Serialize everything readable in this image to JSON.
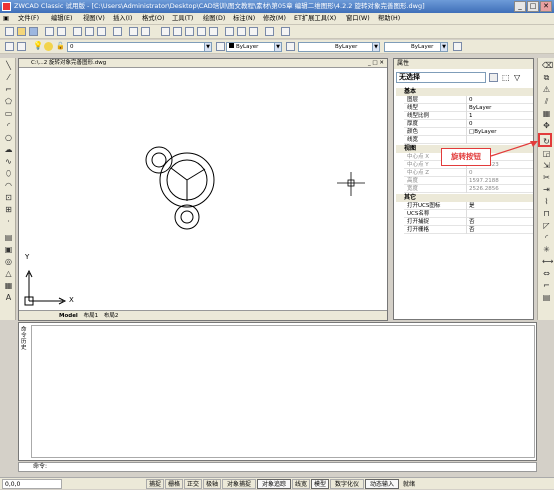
{
  "window": {
    "title": "ZWCAD Classic 试用版 - [C:\\Users\\Administrator\\Desktop\\CAD培训\\图文教程\\素材\\第05章 编辑二维图形\\4.2.2 旋转对象完善图形.dwg]",
    "min": "_",
    "max": "□",
    "close": "✕"
  },
  "menu": [
    "文件(F)",
    "编辑(E)",
    "视图(V)",
    "插入(I)",
    "格式(O)",
    "工具(T)",
    "绘图(D)",
    "标注(N)",
    "修改(M)",
    "ET扩展工具(X)",
    "窗口(W)",
    "帮助(H)"
  ],
  "toolbar": {
    "layer_value": "0",
    "color_value": "ByLayer",
    "linetype_value": "ByLayer",
    "lineweight_value": "ByLayer"
  },
  "document": {
    "tab_title": "C:\\...2  旋转对象完善图形.dwg",
    "layout_tabs": [
      "Model",
      "布局1",
      "布局2"
    ],
    "axis_y": "Y",
    "axis_x": "X"
  },
  "properties": {
    "header": "属性",
    "selection": "无选择",
    "sections": [
      {
        "title": "基本",
        "rows": [
          {
            "key": "图层",
            "value": "0"
          },
          {
            "key": "线型",
            "value": "ByLayer"
          },
          {
            "key": "线型比例",
            "value": "1"
          },
          {
            "key": "厚度",
            "value": "0"
          },
          {
            "key": "颜色",
            "value": "□ByLayer"
          },
          {
            "key": "线宽",
            "value": ""
          }
        ]
      },
      {
        "title": "视图",
        "rows": [
          {
            "key": "中心点 X",
            "value": ""
          },
          {
            "key": "中心点 Y",
            "value": "1080.1323"
          },
          {
            "key": "中心点 Z",
            "value": "0"
          },
          {
            "key": "高度",
            "value": "1597.2188"
          },
          {
            "key": "宽度",
            "value": "2526.2856"
          }
        ]
      },
      {
        "title": "其它",
        "rows": [
          {
            "key": "打开UCS图标",
            "value": "是"
          },
          {
            "key": "UCS名称",
            "value": ""
          },
          {
            "key": "打开捕捉",
            "value": "否"
          },
          {
            "key": "打开栅格",
            "value": "否"
          }
        ]
      }
    ]
  },
  "callout": {
    "label": "旋转按钮",
    "color": "#e23b3b"
  },
  "command": {
    "side_label": "命令历史",
    "prompt": "命令:"
  },
  "status": {
    "coords": "0,0,0",
    "buttons": [
      "捕捉",
      "栅格",
      "正交",
      "极轴",
      "对象捕捉",
      "对象追踪",
      "线宽",
      "模型",
      "数字化仪",
      "动态输入",
      "就绪"
    ]
  }
}
